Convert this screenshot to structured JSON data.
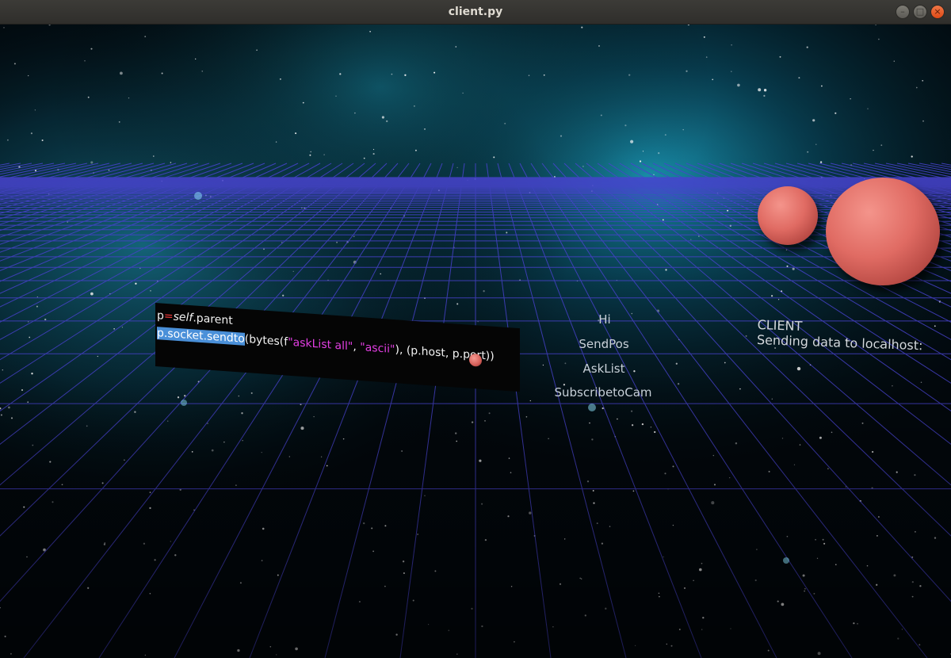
{
  "window": {
    "title": "client.py",
    "buttons": [
      "–",
      "□",
      "×"
    ]
  },
  "code_panel": {
    "line1": {
      "prefix": "p",
      "cursor": "=",
      "keyword": "self",
      "rest": ".parent"
    },
    "line2": {
      "selected": "p.socket.sendto",
      "part1": "(bytes(f",
      "str1": "\"askList all\"",
      "part2": ", ",
      "str2": "\"ascii\"",
      "part3": "), (p.host, p.port))"
    }
  },
  "menu": {
    "items": [
      "Hi",
      "SendPos",
      "AskList",
      "SubscribetoCam"
    ]
  },
  "client_panel": {
    "title": "CLIENT",
    "status": "Sending data to localhost:"
  },
  "colors": {
    "grid": "#4b46d8",
    "sphere": "#e06b63",
    "string": "#e23ee2",
    "selection": "#4a90d9"
  }
}
